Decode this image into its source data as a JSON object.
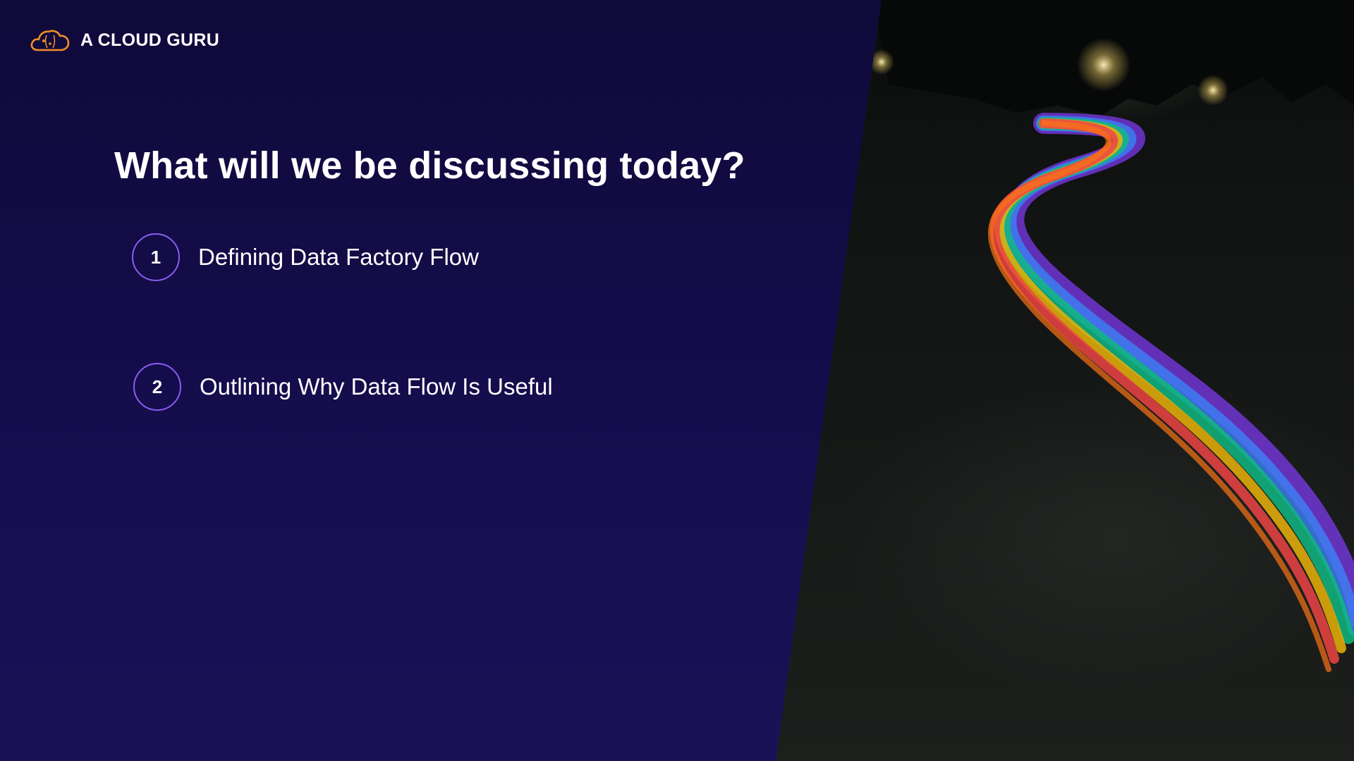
{
  "brand": {
    "name": "A CLOUD GURU",
    "logo_icon": "cloud-logo-icon",
    "accent_color": "#f28c28"
  },
  "slide": {
    "title": "What will we be discussing today?",
    "agenda": [
      {
        "number": "1",
        "label": "Defining Data Factory Flow"
      },
      {
        "number": "2",
        "label": "Outlining Why Data Flow Is Useful"
      }
    ]
  },
  "colors": {
    "background": "#140c4a",
    "circle_outline": "#8b5cf6",
    "text": "#ffffff"
  },
  "photo": {
    "subject": "rainbow light trail on a dark road at night"
  }
}
